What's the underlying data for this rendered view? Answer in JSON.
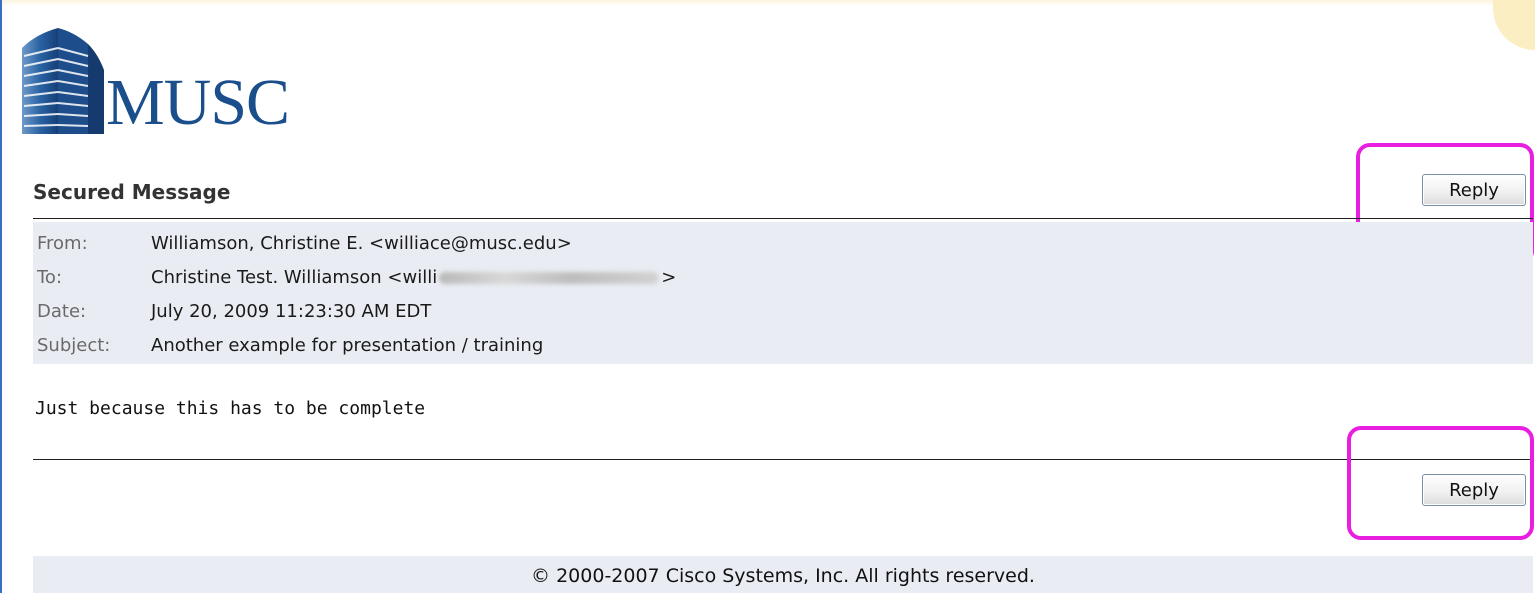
{
  "logo": {
    "text": "MUSC"
  },
  "page_title": "Secured Message",
  "actions": {
    "reply_label": "Reply"
  },
  "message": {
    "headers": [
      {
        "label": "From:",
        "value": "Williamson, Christine E. <williace@musc.edu>"
      },
      {
        "label": "To:",
        "value_prefix": "Christine Test. Williamson <willi",
        "value_suffix": ">"
      },
      {
        "label": "Date:",
        "value": "July 20, 2009 11:23:30 AM EDT"
      },
      {
        "label": "Subject:",
        "value": "Another example for presentation / training"
      }
    ],
    "body": "Just because this has to be complete"
  },
  "footer": {
    "copyright": "© 2000-2007 Cisco Systems, Inc. All rights reserved."
  },
  "colors": {
    "brand_blue": "#1a4f8c",
    "header_bg": "#e9edf3",
    "highlight": "#e81ee0"
  }
}
